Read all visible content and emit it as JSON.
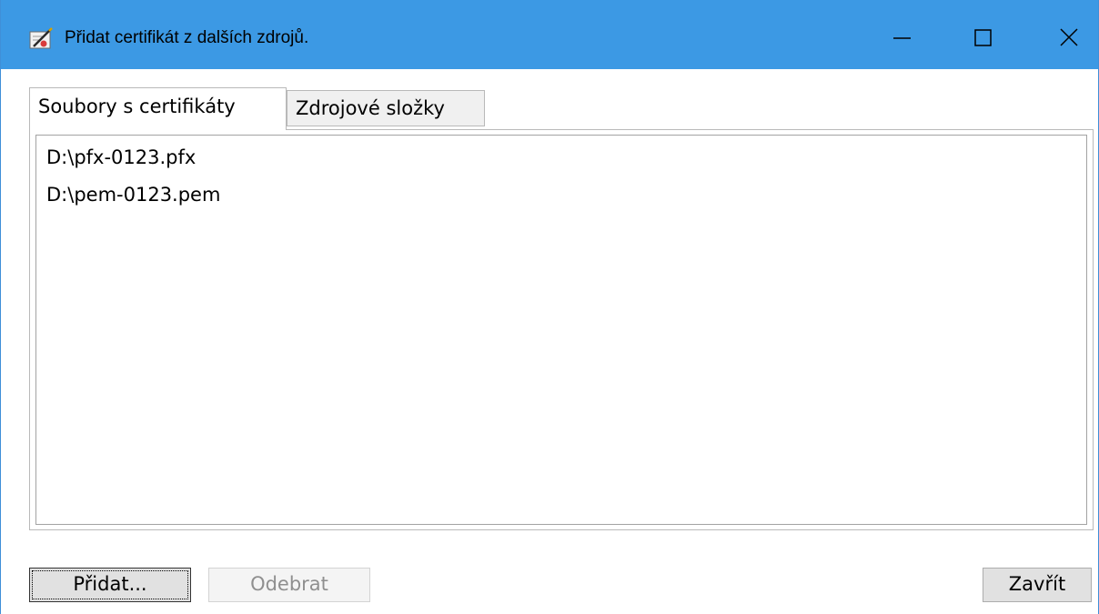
{
  "window": {
    "title": "Přidat certifikát z dalších zdrojů."
  },
  "tabs": [
    {
      "label": "Soubory s certifikáty",
      "active": true
    },
    {
      "label": "Zdrojové složky",
      "active": false
    }
  ],
  "file_list": {
    "items": [
      "D:\\pfx-0123.pfx",
      "D:\\pem-0123.pem"
    ]
  },
  "buttons": {
    "add_label": "Přidat...",
    "remove_label": "Odebrat",
    "close_label": "Zavřít"
  },
  "colors": {
    "titlebar": "#3c99e4",
    "tab_inactive_bg": "#f0f0f0",
    "button_bg": "#e1e1e1",
    "disabled_text": "#8f8f8f"
  },
  "icons": {
    "app": "certificate-pen-icon",
    "minimize": "minimize-icon",
    "maximize": "maximize-icon",
    "close": "close-icon"
  }
}
